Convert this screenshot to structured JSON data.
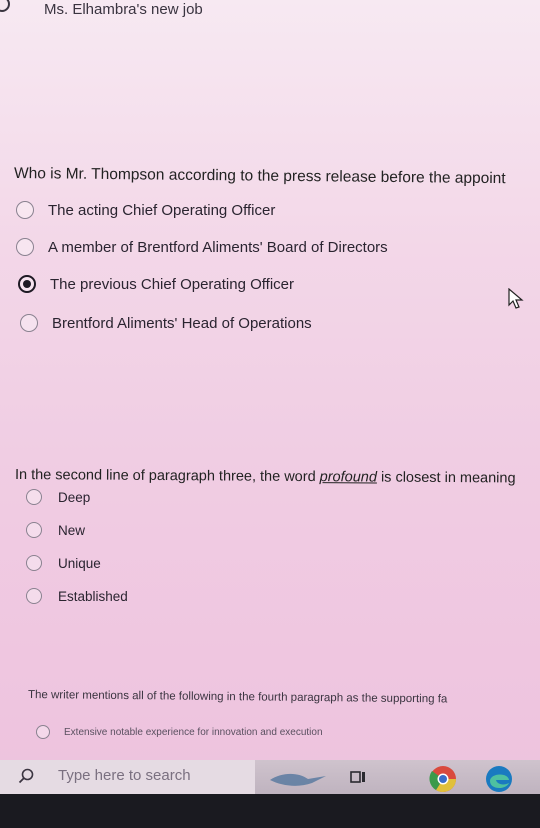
{
  "top_option": {
    "label": "Ms. Elhambra's new job"
  },
  "question1": {
    "text": "Who is Mr. Thompson according to the press release before the appoint",
    "options": [
      {
        "label": "The acting Chief Operating Officer",
        "selected": false
      },
      {
        "label": "A member of Brentford Aliments' Board of Directors",
        "selected": false
      },
      {
        "label": "The previous Chief Operating Officer",
        "selected": true
      },
      {
        "label": "Brentford Aliments' Head of Operations",
        "selected": false
      }
    ]
  },
  "question2": {
    "text_before": "In the second line of paragraph three, the word ",
    "keyword": "profound",
    "text_after": " is closest in meaning",
    "options": [
      {
        "label": "Deep"
      },
      {
        "label": "New"
      },
      {
        "label": "Unique"
      },
      {
        "label": "Established"
      }
    ]
  },
  "question3": {
    "text": "The writer mentions all of the following in the fourth paragraph as the supporting fa",
    "options": [
      {
        "label": "Extensive notable experience for innovation and execution"
      }
    ]
  },
  "taskbar": {
    "search_placeholder": "Type here to search",
    "icons": [
      "search-icon",
      "cortana-icon",
      "task-view-icon",
      "chrome-icon",
      "edge-icon"
    ]
  }
}
